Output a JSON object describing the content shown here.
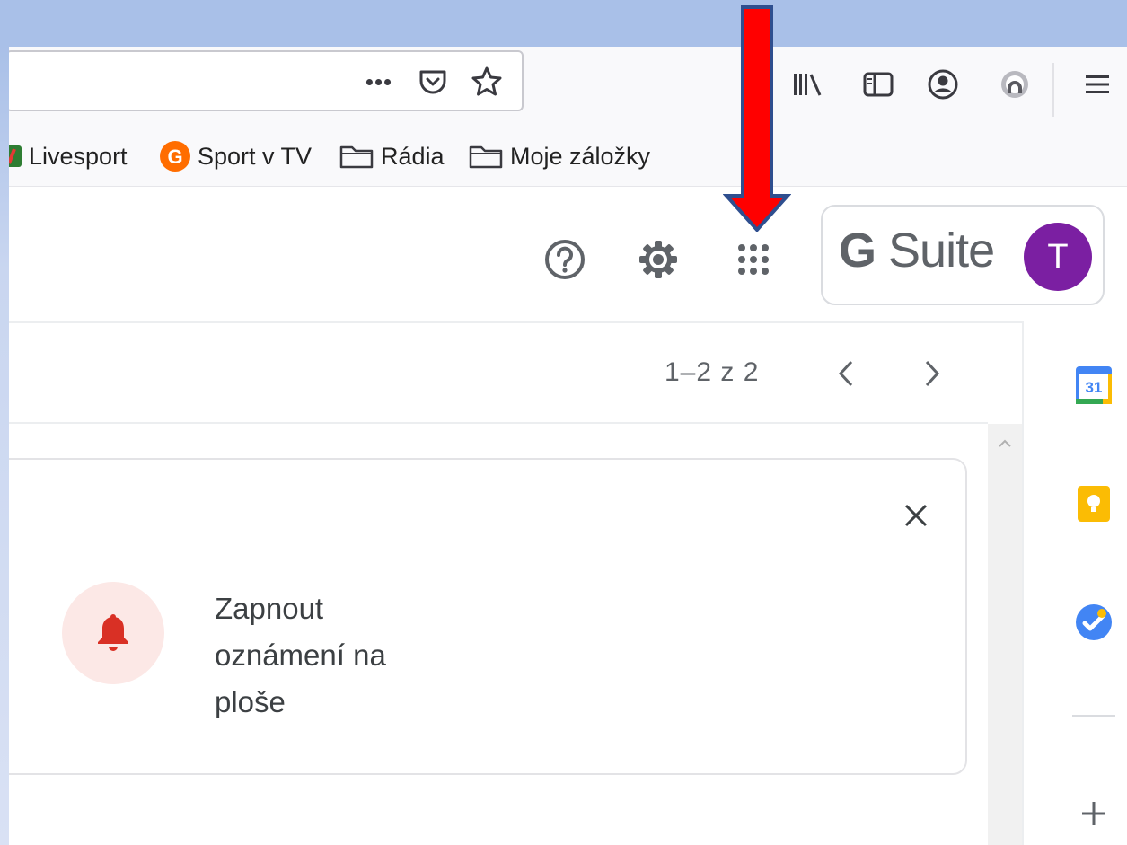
{
  "toolbar": {
    "url_icons": [
      "more-dots-icon",
      "pocket-icon",
      "bookmark-star-icon"
    ],
    "more_label": "•••",
    "right_icons": [
      "library-icon",
      "sidebar-icon",
      "account-icon",
      "extension-icon",
      "hamburger-menu-icon"
    ]
  },
  "bookmarks": [
    {
      "label": "Livesport",
      "icon": "livesport-favicon"
    },
    {
      "label": "Sport v TV",
      "icon": "sport-tv-favicon"
    },
    {
      "label": "Rádia",
      "icon": "folder-icon"
    },
    {
      "label": "Moje záložky",
      "icon": "folder-icon"
    }
  ],
  "header": {
    "icons": [
      "help-icon",
      "settings-gear-icon",
      "apps-grid-icon"
    ],
    "gsuite_g": "G",
    "gsuite_suite": " Suite",
    "avatar_initial": "T"
  },
  "pager": {
    "text": "1–2 z 2"
  },
  "notification": {
    "text": "Zapnout oznámení na ploše"
  },
  "side_panel_icons": [
    "google-calendar-icon",
    "google-keep-icon",
    "google-tasks-icon",
    "add-addon-icon"
  ],
  "calendar_day": "31",
  "colors": {
    "arrow_red": "#ff0000",
    "arrow_outline": "#2f4f8f",
    "avatar_purple": "#7b1fa2",
    "bell_red": "#d93025"
  }
}
